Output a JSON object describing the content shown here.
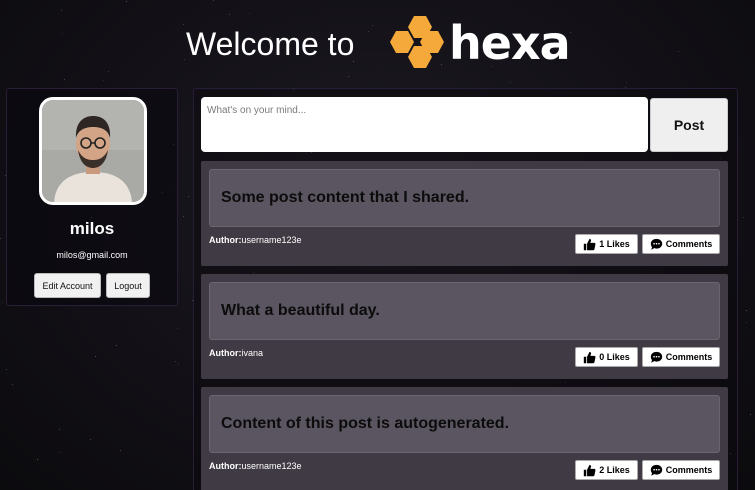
{
  "header": {
    "welcome_text": "Welcome to",
    "logo_text": "hexa",
    "logo_color": "#f4a93a"
  },
  "profile": {
    "username": "milos",
    "email": "milos@gmail.com",
    "edit_label": "Edit Account",
    "logout_label": "Logout"
  },
  "composer": {
    "placeholder": "What's on your mind...",
    "value": "",
    "post_label": "Post"
  },
  "posts": [
    {
      "content": "Some post content that I shared.",
      "author_label": "Author:",
      "author": "username123e",
      "likes_label": "1 Likes",
      "comments_label": "Comments"
    },
    {
      "content": "What a beautiful day.",
      "author_label": "Author:",
      "author": "ivana",
      "likes_label": "0 Likes",
      "comments_label": "Comments"
    },
    {
      "content": "Content of this post is autogenerated.",
      "author_label": "Author:",
      "author": "username123e",
      "likes_label": "2 Likes",
      "comments_label": "Comments"
    }
  ],
  "icons": {
    "like": "thumbs-up-icon",
    "comment": "speech-bubble-icon",
    "logo": "hexagon-cluster-logo"
  }
}
